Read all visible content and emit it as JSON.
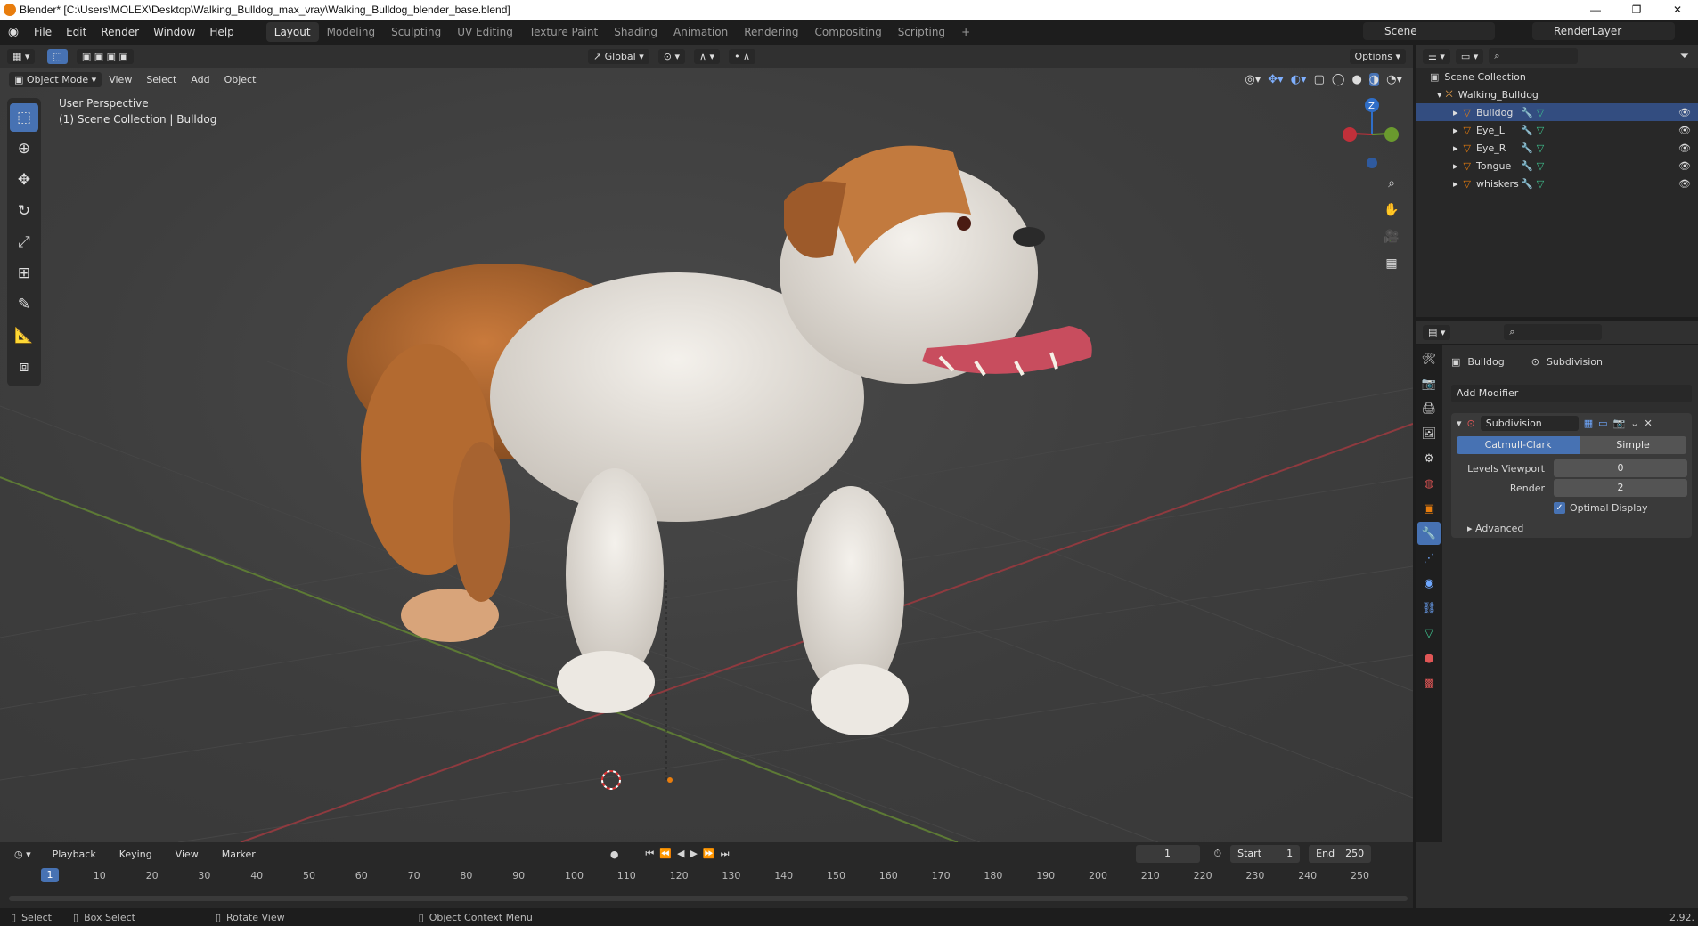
{
  "window": {
    "title": "Blender* [C:\\Users\\MOLEX\\Desktop\\Walking_Bulldog_max_vray\\Walking_Bulldog_blender_base.blend]",
    "controls": [
      "—",
      "❐",
      "✕"
    ]
  },
  "menu": {
    "items": [
      "File",
      "Edit",
      "Render",
      "Window",
      "Help"
    ]
  },
  "workspaces": {
    "tabs": [
      "Layout",
      "Modeling",
      "Sculpting",
      "UV Editing",
      "Texture Paint",
      "Shading",
      "Animation",
      "Rendering",
      "Compositing",
      "Scripting"
    ],
    "add": "+"
  },
  "scene": {
    "name": "Scene",
    "view_layer": "RenderLayer"
  },
  "viewport_header": {
    "mode": "Object Mode",
    "menus": [
      "View",
      "Select",
      "Add",
      "Object"
    ],
    "orientation": "Global",
    "options": "Options"
  },
  "viewport": {
    "perspective": "User Perspective",
    "collection": "(1) Scene Collection | Bulldog",
    "gizmo_z": "Z"
  },
  "outliner": {
    "root": "Scene Collection",
    "collection": "Walking_Bulldog",
    "objects": [
      "Bulldog",
      "Eye_L",
      "Eye_R",
      "Tongue",
      "whiskers"
    ]
  },
  "properties": {
    "object": "Bulldog",
    "modifier_context": "Subdivision",
    "add_modifier": "Add Modifier",
    "modifier": {
      "name": "Subdivision",
      "types": [
        "Catmull-Clark",
        "Simple"
      ],
      "levels_viewport_label": "Levels Viewport",
      "levels_viewport": "0",
      "render_label": "Render",
      "render": "2",
      "optimal_display": "Optimal Display",
      "advanced": "Advanced"
    }
  },
  "timeline": {
    "menus": [
      "Playback",
      "Keying",
      "View",
      "Marker"
    ],
    "current_frame": "1",
    "start_label": "Start",
    "start": "1",
    "end_label": "End",
    "end": "250",
    "ruler": [
      "10",
      "20",
      "30",
      "40",
      "50",
      "60",
      "70",
      "80",
      "90",
      "100",
      "110",
      "120",
      "130",
      "140",
      "150",
      "160",
      "170",
      "180",
      "190",
      "200",
      "210",
      "220",
      "230",
      "240",
      "250"
    ]
  },
  "status": {
    "select": "Select",
    "box_select": "Box Select",
    "rotate": "Rotate View",
    "context": "Object Context Menu",
    "version": "2.92."
  },
  "colors": {
    "accent": "#4772b3",
    "x_axis": "#c0303a",
    "y_axis": "#6a9a2e",
    "z_axis": "#2f6ec8",
    "origin": "#e87d0d"
  },
  "icons": [
    "blender-logo-icon",
    "select-box-icon",
    "cursor-icon",
    "move-icon",
    "rotate-icon",
    "scale-icon",
    "transform-icon",
    "annotate-icon",
    "measure-icon",
    "add-cube-icon",
    "zoom-icon",
    "hand-icon",
    "camera-icon",
    "grid-icon",
    "wrench-icon",
    "eye-icon"
  ]
}
